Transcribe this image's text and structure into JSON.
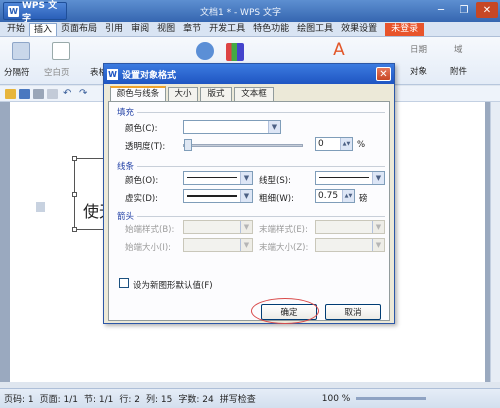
{
  "app": {
    "name": "WPS 文字",
    "doc_title": "文档1 * - WPS 文字",
    "app_icon": "W"
  },
  "window_controls": {
    "minimize": "─",
    "restore": "❐",
    "close": "✕"
  },
  "menu": {
    "items": [
      "开始",
      "插入",
      "页面布局",
      "引用",
      "审阅",
      "视图",
      "章节",
      "开发工具",
      "特色功能",
      "绘图工具",
      "效果设置"
    ],
    "active_index": 1,
    "register_label": "未登录"
  },
  "ribbon": {
    "pagination_label": "分隔符",
    "blank_page_label": "空白页",
    "table_label": "表格",
    "date_label": "日期",
    "field_label": "域",
    "object_label": "对象",
    "attachment_label": "附件"
  },
  "dialog": {
    "title": "设置对象格式",
    "title_icon": "W",
    "close_glyph": "✕",
    "tabs": [
      "颜色与线条",
      "大小",
      "版式",
      "文本框"
    ],
    "active_tab": 0,
    "fill": {
      "section": "填充",
      "color_label": "颜色(C):",
      "transparency_label": "透明度(T):",
      "transparency_value": "0",
      "transparency_unit": "%"
    },
    "line": {
      "section": "线条",
      "color_label": "颜色(O):",
      "style_label": "线型(S):",
      "dash_label": "虚实(D):",
      "weight_label": "粗细(W):",
      "weight_value": "0.75",
      "weight_unit": "磅"
    },
    "arrows": {
      "section": "箭头",
      "begin_style_label": "始端样式(B):",
      "end_style_label": "末端样式(E):",
      "begin_size_label": "始端大小(I):",
      "end_size_label": "末端大小(Z):"
    },
    "default_checkbox_label": "设为新图形默认值(F)",
    "ok_label": "确定",
    "cancel_label": "取消"
  },
  "document": {
    "textbox_text": "使无"
  },
  "statusbar": {
    "page": "页码: 1",
    "pages": "页面: 1/1",
    "section": "节: 1/1",
    "row": "行: 2",
    "col": "列: 15",
    "words": "字数: 24",
    "spell": "拼写检查",
    "zoom": "100 %"
  },
  "colors": {
    "accent": "#1f55c2",
    "highlight_ring": "#d94a4a"
  }
}
